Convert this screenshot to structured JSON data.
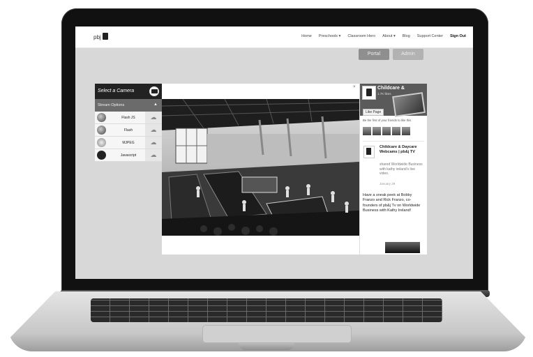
{
  "nav": {
    "logo_text": "pbj",
    "links": [
      "Home",
      "Preschools ▾",
      "Classroom Hero",
      "About ▾",
      "Blog",
      "Support Center"
    ],
    "signout": "Sign Out"
  },
  "buttons": {
    "portal": "Portal",
    "admin": "Admin"
  },
  "camera_panel": {
    "title": "Select a Camera",
    "stream_options": "Stream Options",
    "stream_arrow": "▲",
    "options": [
      {
        "label": "Flash JS",
        "icon": "flash-js-icon"
      },
      {
        "label": "Flash",
        "icon": "flash-icon"
      },
      {
        "label": "MJPEG",
        "icon": "mjpeg-icon"
      },
      {
        "label": "Javascript",
        "icon": "javascript-icon"
      }
    ],
    "download_glyph": "☁"
  },
  "video": {
    "close": "×"
  },
  "facebook": {
    "page_name": "Childcare &",
    "likes": "1.7K likes",
    "like_button": "Like Page",
    "friends_text": "Be the first of your friends to like this",
    "post": {
      "author": "Childcare & Daycare Webcams | pb&j TV",
      "shared": "shared Worldwide Business with kathy ireland's live video.",
      "date": "January 29",
      "text": "Have a sneak peek at Bobby Franzo and Rick Franzo, co-founders of pb&j Tv on Worldwide Business with Kathy Ireland!"
    }
  },
  "colors": {
    "screen_bg": "#d8d8d8",
    "panel_dark": "#222222",
    "bezel": "#111111"
  }
}
